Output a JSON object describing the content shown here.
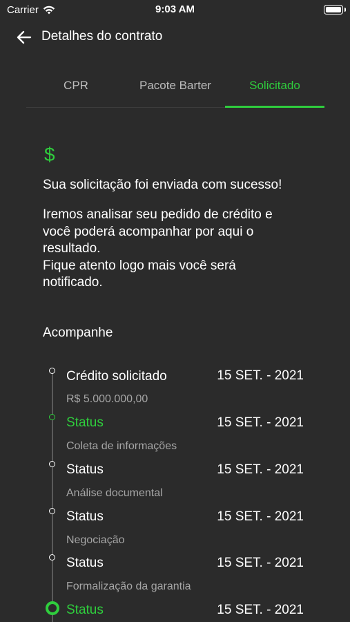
{
  "status_bar": {
    "carrier": "Carrier",
    "time": "9:03 AM"
  },
  "header": {
    "title": "Detalhes do contrato"
  },
  "tabs": [
    {
      "label": "CPR",
      "active": false
    },
    {
      "label": "Pacote Barter",
      "active": false
    },
    {
      "label": "Solicitado",
      "active": true
    }
  ],
  "content": {
    "icon": "$",
    "success_message": "Sua solicitação foi enviada com sucesso!",
    "info_text": "Iremos analisar seu pedido de crédito e\nvocê poderá acompanhar por aqui o\nresultado.\nFique atento logo mais você será\nnotificado.",
    "follow_label": "Acompanhe"
  },
  "timeline": [
    {
      "title": "Crédito solicitado",
      "date": "15 SET. - 2021",
      "sub": "R$ 5.000.000,00",
      "state": "done"
    },
    {
      "title": "Status",
      "date": "15 SET. - 2021",
      "sub": "Coleta de informações",
      "state": "active"
    },
    {
      "title": "Status",
      "date": "15 SET. - 2021",
      "sub": "Análise documental",
      "state": "pending"
    },
    {
      "title": "Status",
      "date": "15 SET. - 2021",
      "sub": "Negociação",
      "state": "pending"
    },
    {
      "title": "Status",
      "date": "15 SET. - 2021",
      "sub": "Formalização da garantia",
      "state": "pending"
    },
    {
      "title": "Status",
      "date": "15 SET. - 2021",
      "sub": "",
      "state": "current"
    }
  ],
  "colors": {
    "accent": "#2fcd3d",
    "background": "#2b2b2b",
    "muted": "#a6a6a6"
  },
  "icons": {
    "back": "arrow-left-icon",
    "wifi": "wifi-icon",
    "battery": "battery-icon"
  }
}
